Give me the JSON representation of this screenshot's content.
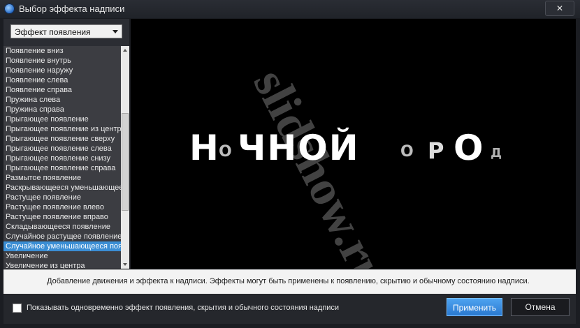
{
  "window": {
    "title": "Выбор эффекта надписи",
    "close_symbol": "✕",
    "icon": "app-logo-icon"
  },
  "effect_type": {
    "selected": "Эффект появления"
  },
  "effects_list": {
    "selected_index": 20,
    "items": [
      "Появление вниз",
      "Появление внутрь",
      "Появление наружу",
      "Появление слева",
      "Появление справа",
      "Пружина слева",
      "Пружина справа",
      "Прыгающее появление",
      "Прыгающее появление из центра",
      "Прыгающее появление сверху",
      "Прыгающее появление слева",
      "Прыгающее появление снизу",
      "Прыгающее появление справа",
      "Размытое появление",
      "Раскрывающееся уменьшающееся",
      "Растущее появление",
      "Растущее появление влево",
      "Растущее появление вправо",
      "Складывающееся появление",
      "Случайное растущее появление",
      "Случайное уменьшающееся появление",
      "Увеличение",
      "Увеличение из центра"
    ]
  },
  "preview": {
    "letters": [
      {
        "t": "Н",
        "size": "big"
      },
      {
        "t": "О",
        "size": "small"
      },
      {
        "t": "ЧНОЙ",
        "size": "big"
      },
      {
        "t": "О",
        "size": "small"
      },
      {
        "t": "Р",
        "size": "mid"
      },
      {
        "t": "О",
        "size": "big"
      },
      {
        "t": "Д",
        "size": "tiny"
      }
    ],
    "watermark": "slidshow.ru"
  },
  "info": {
    "text": "Добавление движения и эффекта к надписи. Эффекты могут быть применены к появлению, скрытию и обычному состоянию надписи."
  },
  "footer": {
    "checkbox_label": "Показывать одновременно эффект появления, скрытия и обычного состояния надписи",
    "checkbox_checked": false,
    "apply_label": "Применить",
    "cancel_label": "Отмена"
  },
  "colors": {
    "accent": "#3b8ed4",
    "apply_button": "#2a79d0"
  }
}
